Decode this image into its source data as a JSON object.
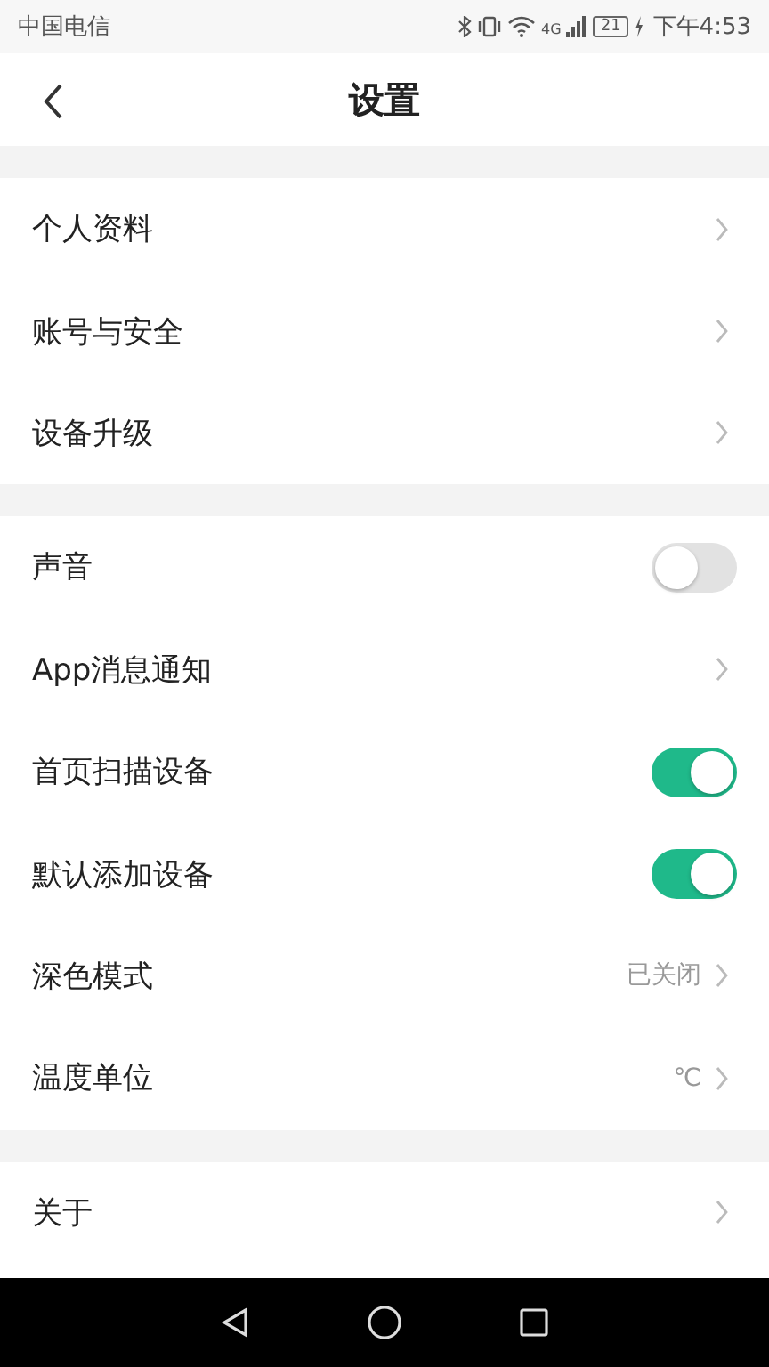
{
  "status_bar": {
    "carrier": "中国电信",
    "network": "4G",
    "battery": "21",
    "time": "下午4:53"
  },
  "header": {
    "title": "设置"
  },
  "sections": [
    {
      "items": [
        {
          "kind": "link",
          "label": "个人资料"
        },
        {
          "kind": "link",
          "label": "账号与安全"
        },
        {
          "kind": "link",
          "label": "设备升级"
        }
      ]
    },
    {
      "items": [
        {
          "kind": "toggle",
          "label": "声音",
          "on": false
        },
        {
          "kind": "link",
          "label": "App消息通知"
        },
        {
          "kind": "toggle",
          "label": "首页扫描设备",
          "on": true
        },
        {
          "kind": "toggle",
          "label": "默认添加设备",
          "on": true
        },
        {
          "kind": "link",
          "label": "深色模式",
          "value": "已关闭"
        },
        {
          "kind": "link",
          "label": "温度单位",
          "value": "℃"
        }
      ]
    },
    {
      "items": [
        {
          "kind": "link",
          "label": "关于"
        }
      ]
    }
  ]
}
